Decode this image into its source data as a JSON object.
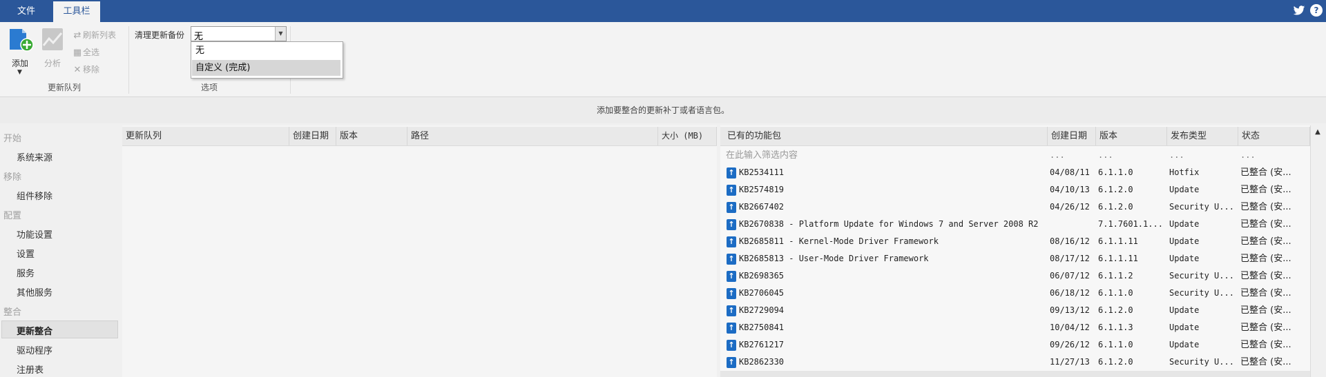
{
  "tabs": {
    "file": "文件",
    "tools": "工具栏"
  },
  "ribbon": {
    "add_label": "添加",
    "analyze_label": "分析",
    "refresh_label": "刷新列表",
    "select_all_label": "全选",
    "remove_label": "移除",
    "queue_group_label": "更新队列",
    "cleanup_label": "清理更新备份",
    "cleanup_value": "无",
    "options_group_label": "选项",
    "dropdown_options": [
      "无",
      "自定义 (完成)"
    ]
  },
  "banner": "添加要整合的更新补丁或者语言包。",
  "sidebar": {
    "start_header": "开始",
    "system_source": "系统来源",
    "remove_header": "移除",
    "component_removal": "组件移除",
    "config_header": "配置",
    "feature_settings": "功能设置",
    "settings": "设置",
    "services": "服务",
    "other_services": "其他服务",
    "integrate_header": "整合",
    "update_integration": "更新整合",
    "drivers": "驱动程序",
    "registry": "注册表"
  },
  "queue_table": {
    "headers": [
      "更新队列",
      "创建日期",
      "版本",
      "路径",
      "大小 (MB)"
    ]
  },
  "packages_table": {
    "headers": [
      "已有的功能包",
      "创建日期",
      "版本",
      "发布类型",
      "状态"
    ],
    "filter_placeholder": "在此输入筛选内容",
    "filter_dots": "...",
    "rows": [
      {
        "name": "KB2534111",
        "date": "04/08/11",
        "version": "6.1.1.0",
        "type": "Hotfix",
        "status": "已整合 (安..."
      },
      {
        "name": "KB2574819",
        "date": "04/10/13",
        "version": "6.1.2.0",
        "type": "Update",
        "status": "已整合 (安..."
      },
      {
        "name": "KB2667402",
        "date": "04/26/12",
        "version": "6.1.2.0",
        "type": "Security U...",
        "status": "已整合 (安..."
      },
      {
        "name": "KB2670838 - Platform Update for Windows 7 and Server 2008 R2",
        "date": "",
        "version": "7.1.7601.1...",
        "type": "Update",
        "status": "已整合 (安..."
      },
      {
        "name": "KB2685811 - Kernel-Mode Driver Framework",
        "date": "08/16/12",
        "version": "6.1.1.11",
        "type": "Update",
        "status": "已整合 (安..."
      },
      {
        "name": "KB2685813 - User-Mode Driver Framework",
        "date": "08/17/12",
        "version": "6.1.1.11",
        "type": "Update",
        "status": "已整合 (安..."
      },
      {
        "name": "KB2698365",
        "date": "06/07/12",
        "version": "6.1.1.2",
        "type": "Security U...",
        "status": "已整合 (安..."
      },
      {
        "name": "KB2706045",
        "date": "06/18/12",
        "version": "6.1.1.0",
        "type": "Security U...",
        "status": "已整合 (安..."
      },
      {
        "name": "KB2729094",
        "date": "09/13/12",
        "version": "6.1.2.0",
        "type": "Update",
        "status": "已整合 (安..."
      },
      {
        "name": "KB2750841",
        "date": "10/04/12",
        "version": "6.1.1.3",
        "type": "Update",
        "status": "已整合 (安..."
      },
      {
        "name": "KB2761217",
        "date": "09/26/12",
        "version": "6.1.1.0",
        "type": "Update",
        "status": "已整合 (安..."
      },
      {
        "name": "KB2862330",
        "date": "11/27/13",
        "version": "6.1.2.0",
        "type": "Security U...",
        "status": "已整合 (安..."
      }
    ]
  },
  "colors": {
    "title_bar": "#2b579a",
    "kb_icon": "#1c6cc4"
  },
  "icons": {
    "twitter": "twitter-icon",
    "help": "help-icon",
    "add": "add-package-icon",
    "analyze": "analyze-icon",
    "refresh": "refresh-icon",
    "select_all": "select-all-icon",
    "remove": "remove-icon"
  }
}
